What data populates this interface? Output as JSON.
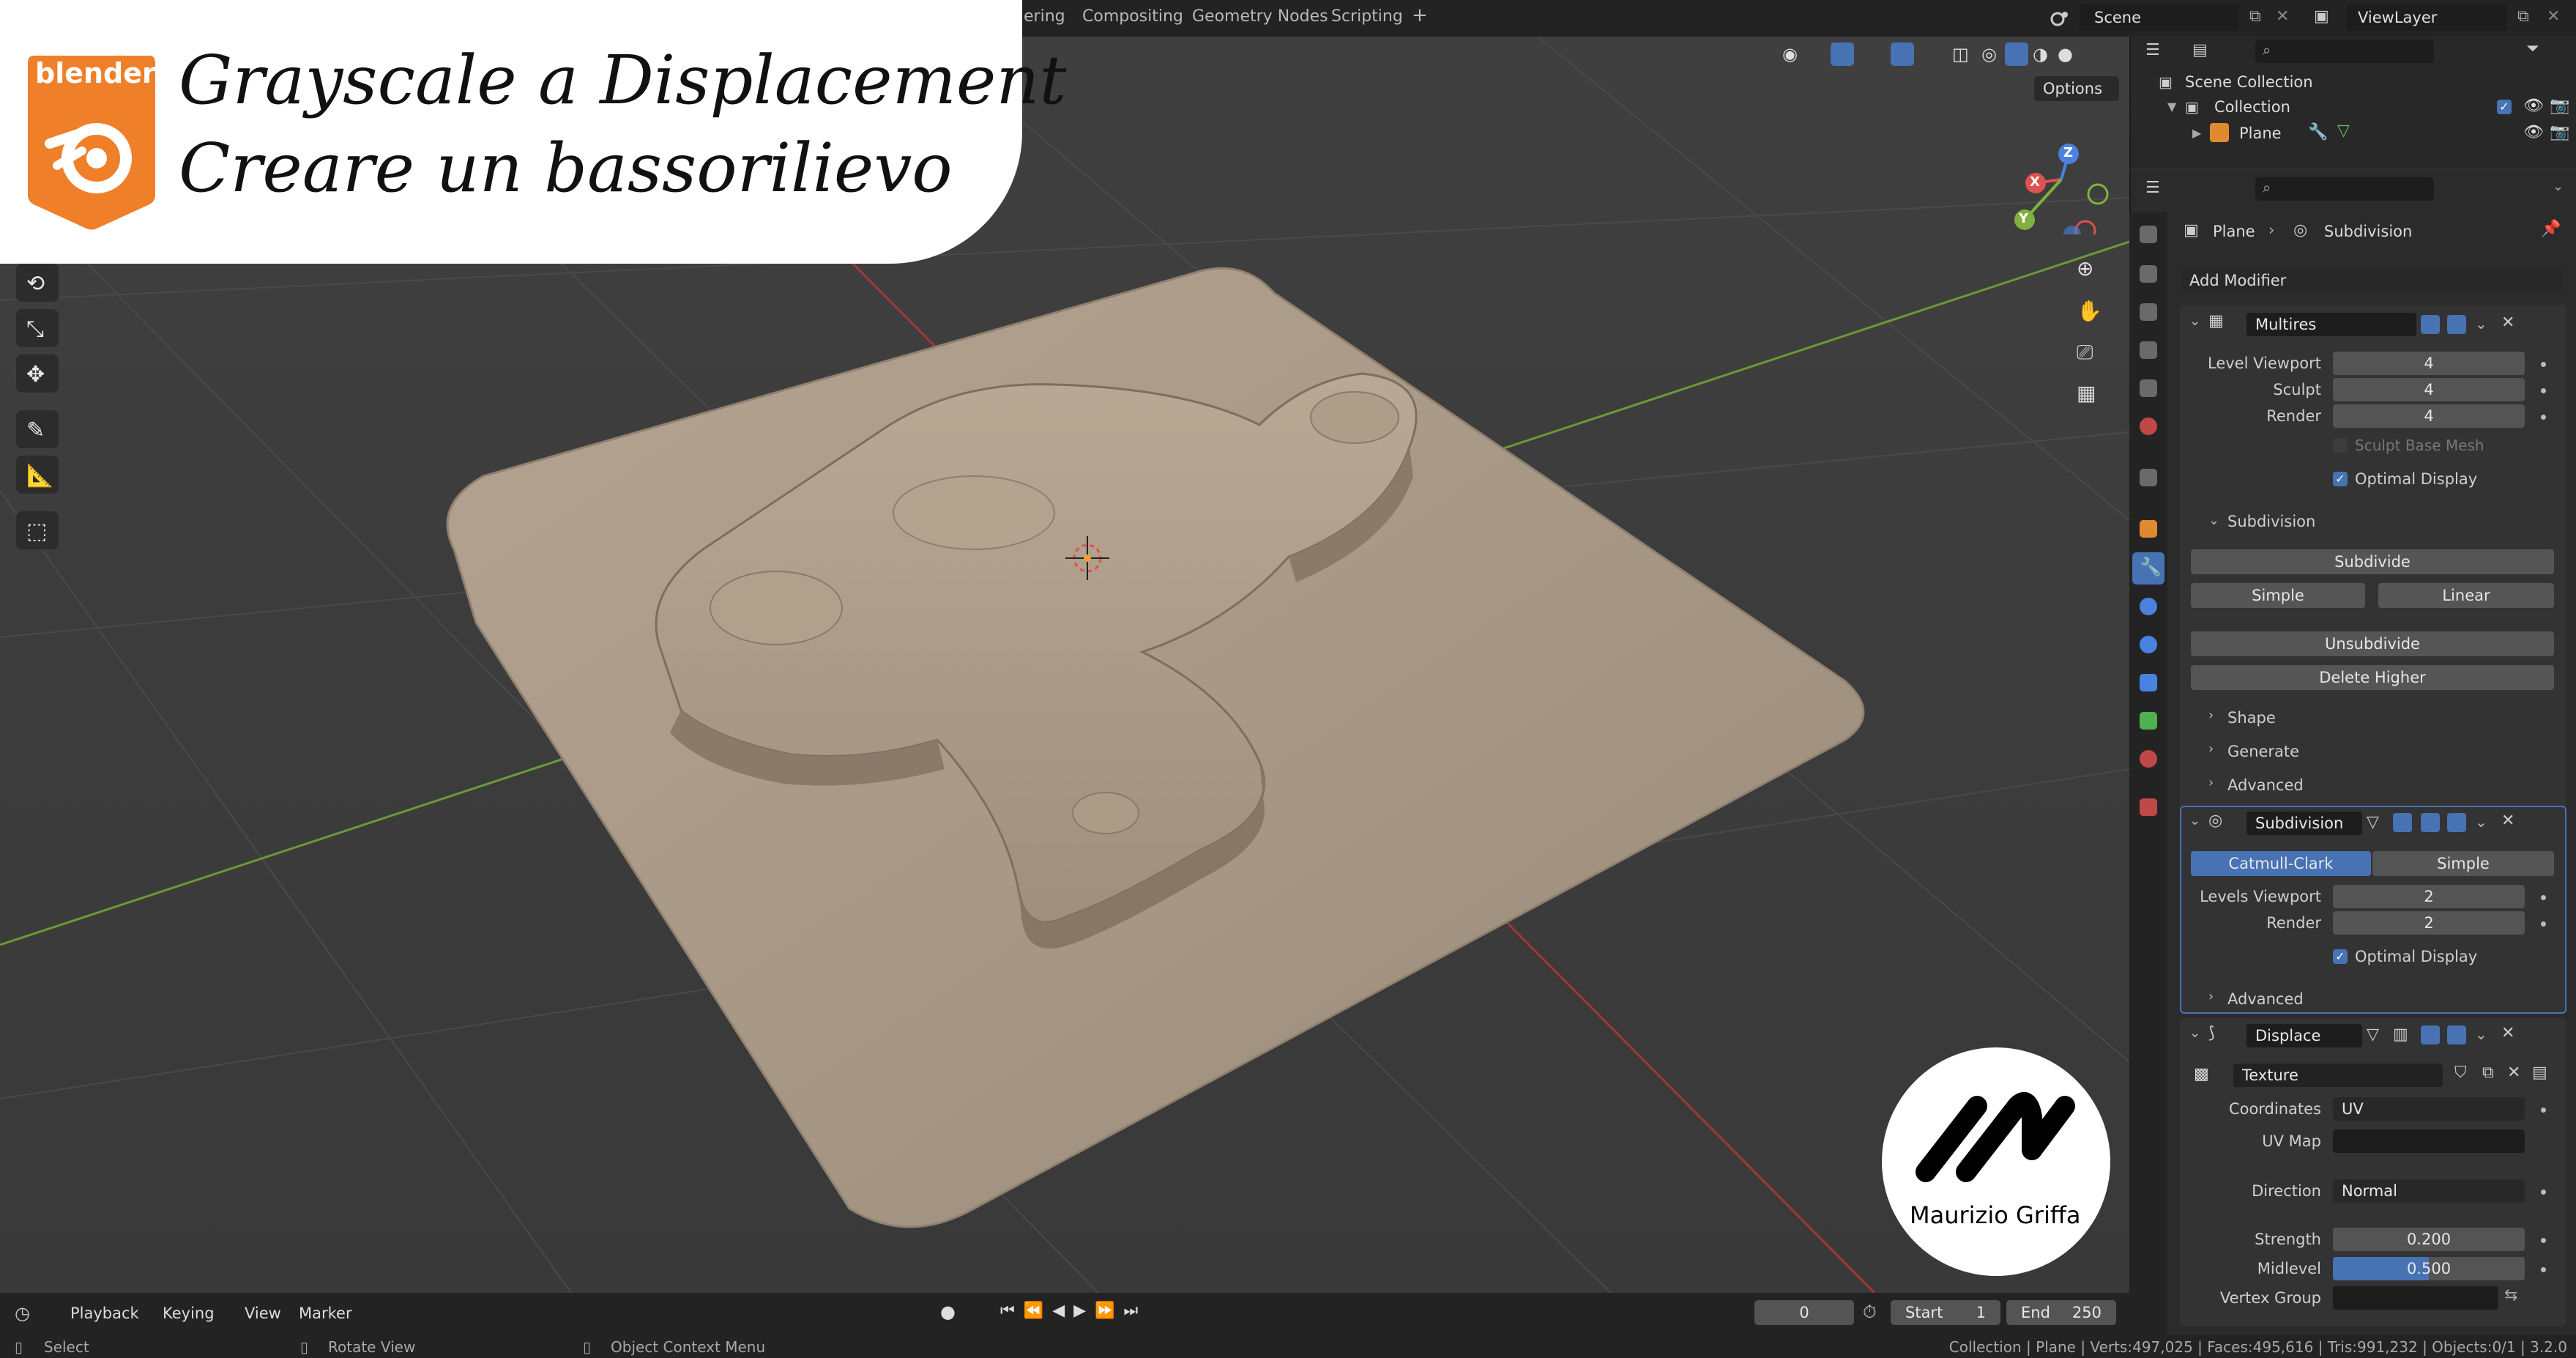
{
  "title_card": {
    "logo_text": "blender",
    "line1": "Grayscale a Displacement",
    "line2": "Creare un bassorilievo"
  },
  "workspaces": [
    "ering",
    "Compositing",
    "Geometry Nodes",
    "Scripting",
    "+"
  ],
  "scene": {
    "label": "Scene",
    "view_layer": "ViewLayer"
  },
  "viewport": {
    "options_label": "Options",
    "axis_x": "X",
    "axis_y": "Y",
    "axis_z": "Z"
  },
  "watermark": {
    "name": "Maurizio Griffa"
  },
  "outliner": {
    "scene_collection": "Scene Collection",
    "collection": "Collection",
    "plane": "Plane"
  },
  "properties": {
    "breadcrumb_object": "Plane",
    "breadcrumb_modifier": "Subdivision",
    "add_modifier": "Add Modifier",
    "multires": {
      "name": "Multires",
      "level_viewport_label": "Level Viewport",
      "level_viewport": "4",
      "sculpt_label": "Sculpt",
      "sculpt": "4",
      "render_label": "Render",
      "render": "4",
      "sculpt_base_mesh": "Sculpt Base Mesh",
      "optimal_display": "Optimal Display",
      "subdivision_section": "Subdivision",
      "subdivide": "Subdivide",
      "simple": "Simple",
      "linear": "Linear",
      "unsubdivide": "Unsubdivide",
      "delete_higher": "Delete Higher",
      "shape": "Shape",
      "generate": "Generate",
      "advanced": "Advanced"
    },
    "subdivision": {
      "name": "Subdivision",
      "catmull_clark": "Catmull-Clark",
      "simple": "Simple",
      "levels_viewport_label": "Levels Viewport",
      "levels_viewport": "2",
      "render_label": "Render",
      "render": "2",
      "optimal_display": "Optimal Display",
      "advanced": "Advanced"
    },
    "displace": {
      "name": "Displace",
      "texture": "Texture",
      "coordinates_label": "Coordinates",
      "coordinates": "UV",
      "uv_map_label": "UV Map",
      "direction_label": "Direction",
      "direction": "Normal",
      "strength_label": "Strength",
      "strength": "0.200",
      "midlevel_label": "Midlevel",
      "midlevel": "0.500",
      "midlevel_fraction": 0.5,
      "vertex_group_label": "Vertex Group"
    }
  },
  "timeline": {
    "playback": "Playback",
    "keying": "Keying",
    "view": "View",
    "marker": "Marker",
    "current_frame": "0",
    "start_label": "Start",
    "start": "1",
    "end_label": "End",
    "end": "250"
  },
  "status": {
    "select": "Select",
    "rotate_view": "Rotate View",
    "context_menu": "Object Context Menu",
    "stats": "Collection | Plane | Verts:497,025 | Faces:495,616 | Tris:991,232 | Objects:0/1 | 3.2.0"
  },
  "colors": {
    "accent_blue": "#4772b3",
    "plane_beige": "#a89886",
    "logo_orange": "#f07f2a"
  }
}
